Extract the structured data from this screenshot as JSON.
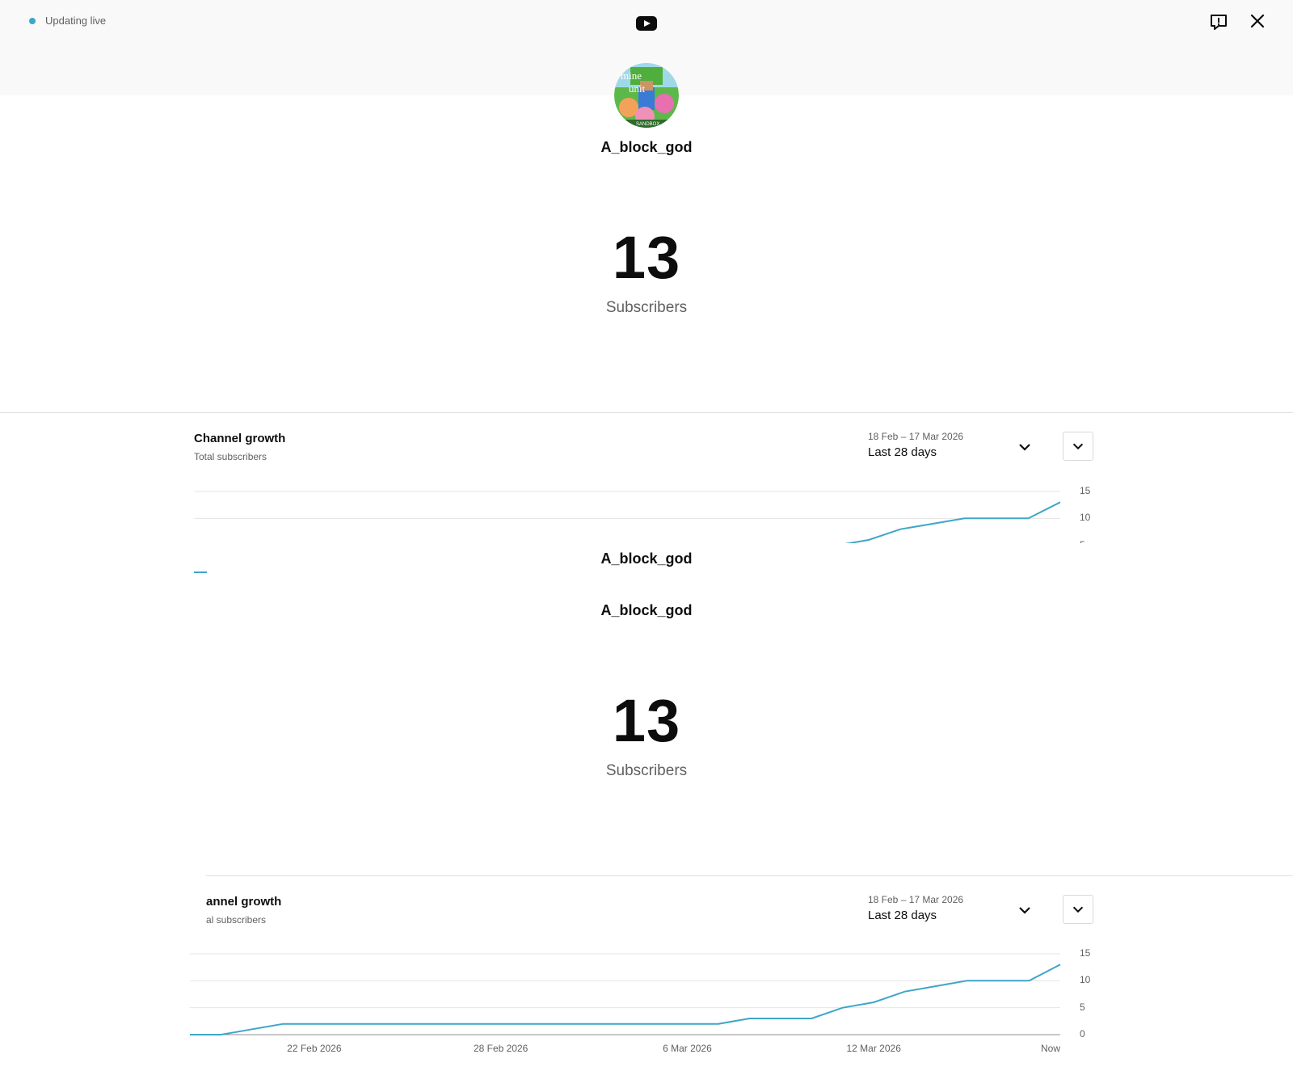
{
  "header": {
    "live_status": "Updating live",
    "logo": "youtube-logo-icon",
    "feedback_icon": "feedback-icon",
    "close_icon": "close-icon"
  },
  "channel": {
    "name": "A_block_god",
    "avatar_icon": "channel-avatar",
    "subscriber_count": "13",
    "subscriber_label": "Subscribers"
  },
  "panel_top": {
    "channel_name_repeat_1": "A_block_god",
    "channel_name_repeat_2": "A_block_god",
    "subscriber_count": "13",
    "subscriber_label": "Subscribers"
  },
  "card1": {
    "title": "Channel growth",
    "subtitle": "Total subscribers",
    "range_dates": "18 Feb – 17 Mar 2026",
    "range_label": "Last 28 days"
  },
  "card2": {
    "title": "annel growth",
    "subtitle": "al subscribers",
    "range_dates": "18 Feb – 17 Mar 2026",
    "range_label": "Last 28 days"
  },
  "colors": {
    "accent": "#3ea6c8",
    "grid": "#e5e5e5",
    "axis": "#909090"
  },
  "chart_data": [
    {
      "type": "line",
      "title": "Channel growth",
      "subtitle": "Total subscribers",
      "series": [
        {
          "name": "",
          "x": [
            "2026-02-18",
            "2026-02-19",
            "2026-02-20",
            "2026-02-21",
            "2026-02-22",
            "2026-02-23",
            "2026-02-24",
            "2026-02-25",
            "2026-02-26",
            "2026-02-27",
            "2026-02-28",
            "2026-03-01",
            "2026-03-02",
            "2026-03-03",
            "2026-03-04",
            "2026-03-05",
            "2026-03-06",
            "2026-03-07",
            "2026-03-08",
            "2026-03-09",
            "2026-03-10",
            "2026-03-11",
            "2026-03-12",
            "2026-03-13",
            "2026-03-14",
            "2026-03-15",
            "2026-03-16",
            "2026-03-17",
            "Now"
          ],
          "values": [
            0,
            0,
            1,
            2,
            2,
            2,
            2,
            2,
            2,
            2,
            2,
            2,
            2,
            2,
            2,
            2,
            2,
            2,
            3,
            3,
            3,
            5,
            6,
            8,
            9,
            10,
            10,
            10,
            13
          ]
        }
      ],
      "x_tick_labels": [
        "22 Feb 2026",
        "28 Feb 2026",
        "6 Mar 2026",
        "12 Mar 2026",
        "Now"
      ],
      "y_tick_labels": [
        "15",
        "10",
        "5",
        "0"
      ],
      "ylim": [
        0,
        15
      ],
      "grid": true
    }
  ]
}
